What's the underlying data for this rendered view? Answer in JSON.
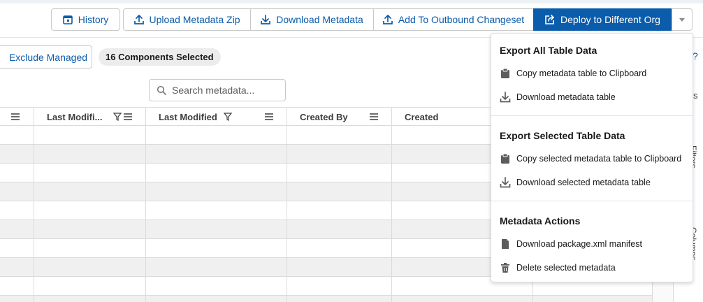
{
  "toolbar": {
    "history": "History",
    "upload_zip": "Upload Metadata Zip",
    "download_metadata": "Download Metadata",
    "add_outbound": "Add To Outbound Changeset",
    "deploy": "Deploy to Different Org"
  },
  "filters": {
    "exclude_managed": "Exclude Managed",
    "selected_badge": "16 Components Selected"
  },
  "search": {
    "placeholder": "Search metadata..."
  },
  "table": {
    "columns": [
      {
        "label": ""
      },
      {
        "label": "Last Modifi..."
      },
      {
        "label": "Last Modified"
      },
      {
        "label": "Created By"
      },
      {
        "label": "Created"
      }
    ],
    "row_count": 10
  },
  "side_panel": {
    "filters_tab": "Filters",
    "columns_tab": "Columns"
  },
  "menu": {
    "sections": [
      {
        "heading": "Export All Table Data",
        "items": [
          {
            "label": "Copy metadata table to Clipboard",
            "icon": "clipboard-icon"
          },
          {
            "label": "Download metadata table",
            "icon": "download-icon"
          }
        ]
      },
      {
        "heading": "Export Selected Table Data",
        "items": [
          {
            "label": "Copy selected metadata table to Clipboard",
            "icon": "clipboard-icon"
          },
          {
            "label": "Download selected metadata table",
            "icon": "download-icon"
          }
        ]
      },
      {
        "heading": "Metadata Actions",
        "items": [
          {
            "label": "Download package.xml manifest",
            "icon": "file-icon"
          },
          {
            "label": "Delete selected metadata",
            "icon": "trash-icon"
          }
        ]
      }
    ]
  },
  "colors": {
    "brand": "#0b5cab",
    "stripe": "#f0f0f0",
    "border": "#dddbda"
  }
}
